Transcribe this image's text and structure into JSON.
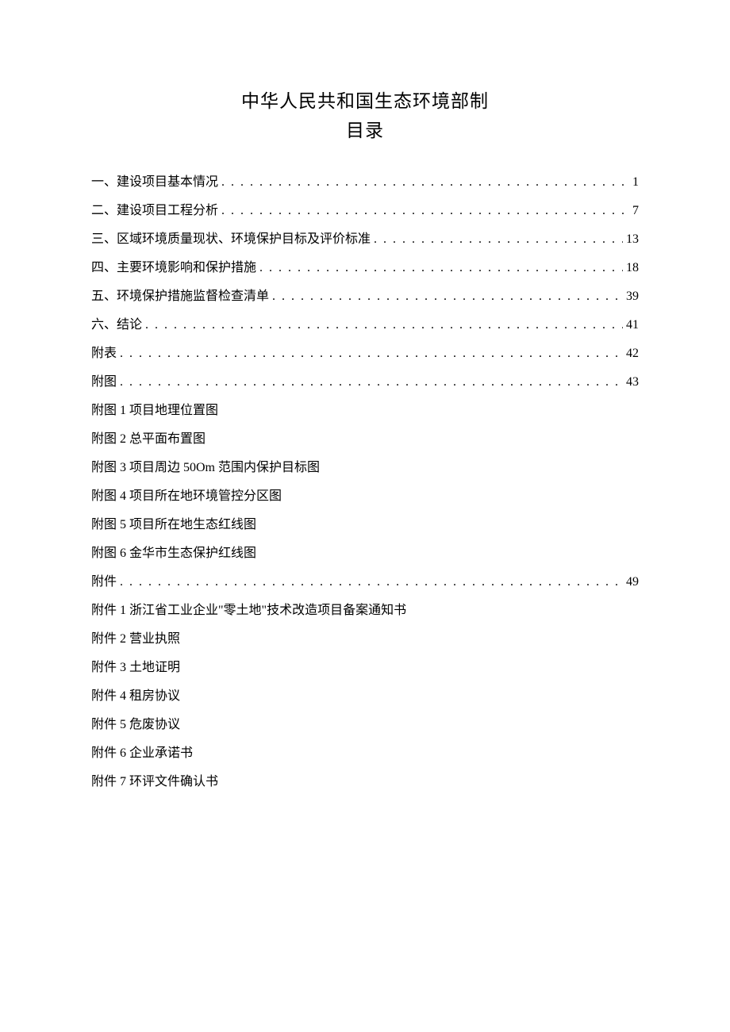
{
  "title": {
    "main": "中华人民共和国生态环境部制",
    "sub": "目录"
  },
  "toc_numbered": [
    {
      "label": "一、建设项目基本情况",
      "page": "1"
    },
    {
      "label": "二、建设项目工程分析",
      "page": "7"
    },
    {
      "label": "三、区域环境质量现状、环境保护目标及评价标准",
      "page": "13"
    },
    {
      "label": "四、主要环境影响和保护措施",
      "page": "18"
    },
    {
      "label": "五、环境保护措施监督检查清单",
      "page": "39"
    },
    {
      "label": "六、结论",
      "page": "41"
    },
    {
      "label": "附表",
      "page": "42"
    },
    {
      "label": "附图",
      "page": "43"
    }
  ],
  "figures": [
    "附图 1 项目地理位置图",
    "附图 2 总平面布置图",
    "附图 3 项目周边 50Om 范围内保护目标图",
    "附图 4 项目所在地环境管控分区图",
    "附图 5 项目所在地生态红线图",
    "附图 6 金华市生态保护红线图"
  ],
  "attachments_header": {
    "label": "附件",
    "page": "49"
  },
  "attachments": [
    "附件 1 浙江省工业企业\"零土地\"技术改造项目备案通知书",
    "附件 2 营业执照",
    "附件 3 土地证明",
    "附件 4 租房协议",
    "附件 5 危废协议",
    "附件 6 企业承诺书",
    "附件 7 环评文件确认书"
  ]
}
